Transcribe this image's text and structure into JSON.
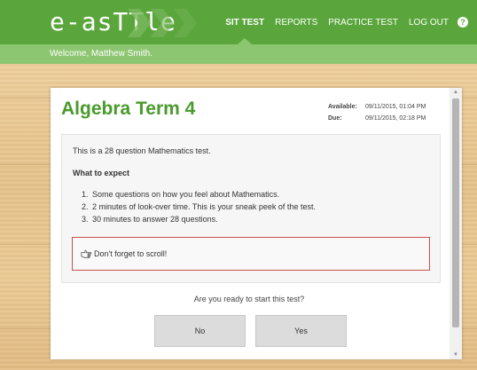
{
  "header": {
    "logo": "e-asTTle",
    "nav": [
      {
        "label": "SIT TEST",
        "active": true
      },
      {
        "label": "REPORTS",
        "active": false
      },
      {
        "label": "PRACTICE TEST",
        "active": false
      },
      {
        "label": "LOG OUT",
        "active": false
      }
    ],
    "help_icon": "?"
  },
  "welcome": "Welcome, Matthew Smith.",
  "test": {
    "title": "Algebra Term 4",
    "available_label": "Available:",
    "available_value": "09/11/2015, 01:04 PM",
    "due_label": "Due:",
    "due_value": "09/11/2015, 02:18 PM",
    "intro": "This is a 28 question Mathematics test.",
    "expect_heading": "What to expect",
    "steps": [
      {
        "num": "1.",
        "text": "Some questions on how you feel about Mathematics."
      },
      {
        "num": "2.",
        "text": "2 minutes of look-over time. This is your sneak peek of the test."
      },
      {
        "num": "3.",
        "text": "30 minutes to answer 28 questions."
      }
    ],
    "scroll_notice": "Don't forget to scroll!",
    "ready_question": "Are you ready to start this test?",
    "no_label": "No",
    "yes_label": "Yes"
  },
  "icons": {
    "notice": "pointing-hand-icon",
    "scroll_up": "▲",
    "scroll_down": "▼"
  },
  "colors": {
    "brand_green": "#5aa63c",
    "light_green": "#8cc670",
    "alert_border": "#c9504f"
  }
}
